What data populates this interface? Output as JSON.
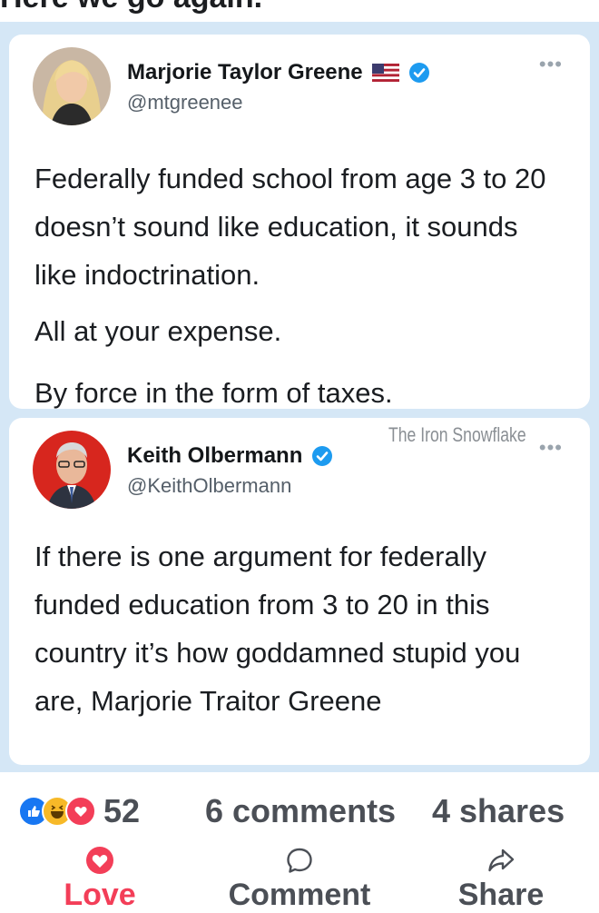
{
  "top_text": "Here we go again.",
  "tweets": [
    {
      "name": "Marjorie Taylor Greene",
      "handle": "@mtgreenee",
      "flag_icon": "us-flag-icon",
      "verified_icon": "verified-badge-icon",
      "more_icon": "more-options-icon",
      "paragraphs": [
        "Federally funded school from age 3 to 20 doesn’t sound like education, it sounds like indoctrination.",
        "All at your expense.",
        "By force in the form of taxes."
      ]
    },
    {
      "name": "Keith Olbermann",
      "handle": "@KeithOlbermann",
      "verified_icon": "verified-badge-icon",
      "more_icon": "more-options-icon",
      "paragraphs": [
        "If there is one argument for federally funded education from 3 to 20 in this country it’s how goddamned stupid you are, Marjorie Traitor Greene"
      ]
    }
  ],
  "watermark": "The Iron Snowflake",
  "stats": {
    "reaction_icons": [
      "like-icon",
      "haha-icon",
      "love-icon"
    ],
    "reaction_count": "52",
    "comments": "6 comments",
    "shares": "4 shares"
  },
  "actions": {
    "love": "Love",
    "comment": "Comment",
    "share": "Share"
  },
  "colors": {
    "verified": "#1d9bf0",
    "love": "#f33e58",
    "background": "#d5e7f6"
  }
}
